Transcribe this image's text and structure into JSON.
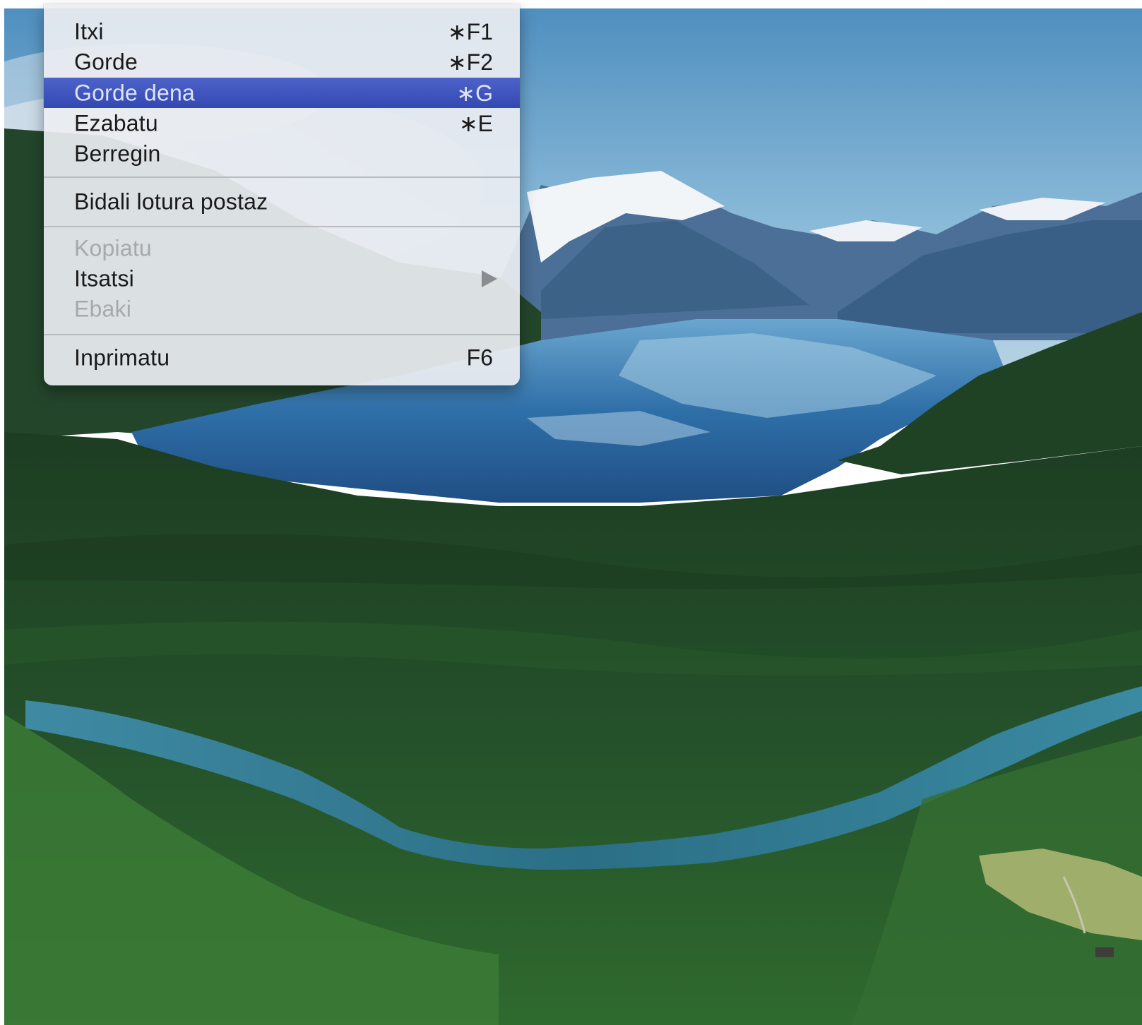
{
  "menu": {
    "groups": [
      {
        "items": [
          {
            "label": "Itxi",
            "shortcut": "∗F1",
            "state": "normal"
          },
          {
            "label": "Gorde",
            "shortcut": "∗F2",
            "state": "normal"
          },
          {
            "label": "Gorde dena",
            "shortcut": "∗G",
            "state": "highlighted"
          },
          {
            "label": "Ezabatu",
            "shortcut": "∗E",
            "state": "normal"
          },
          {
            "label": "Berregin",
            "shortcut": "",
            "state": "normal"
          }
        ]
      },
      {
        "items": [
          {
            "label": "Bidali lotura postaz",
            "shortcut": "",
            "state": "normal"
          }
        ]
      },
      {
        "items": [
          {
            "label": "Kopiatu",
            "shortcut": "",
            "state": "disabled"
          },
          {
            "label": "Itsatsi",
            "shortcut": "",
            "state": "normal",
            "has_submenu": true,
            "submenu_icon": "triangle-right-icon"
          },
          {
            "label": "Ebaki",
            "shortcut": "",
            "state": "disabled"
          }
        ]
      },
      {
        "items": [
          {
            "label": "Inprimatu",
            "shortcut": "F6",
            "state": "normal"
          }
        ]
      }
    ]
  },
  "colors": {
    "menu_background": "#eceef2",
    "highlight": "#3e53bd",
    "text": "#1a1a1a",
    "disabled_text": "#a6a8ad",
    "separator": "#b9bbc0"
  },
  "wallpaper": {
    "type": "landscape photo"
  }
}
